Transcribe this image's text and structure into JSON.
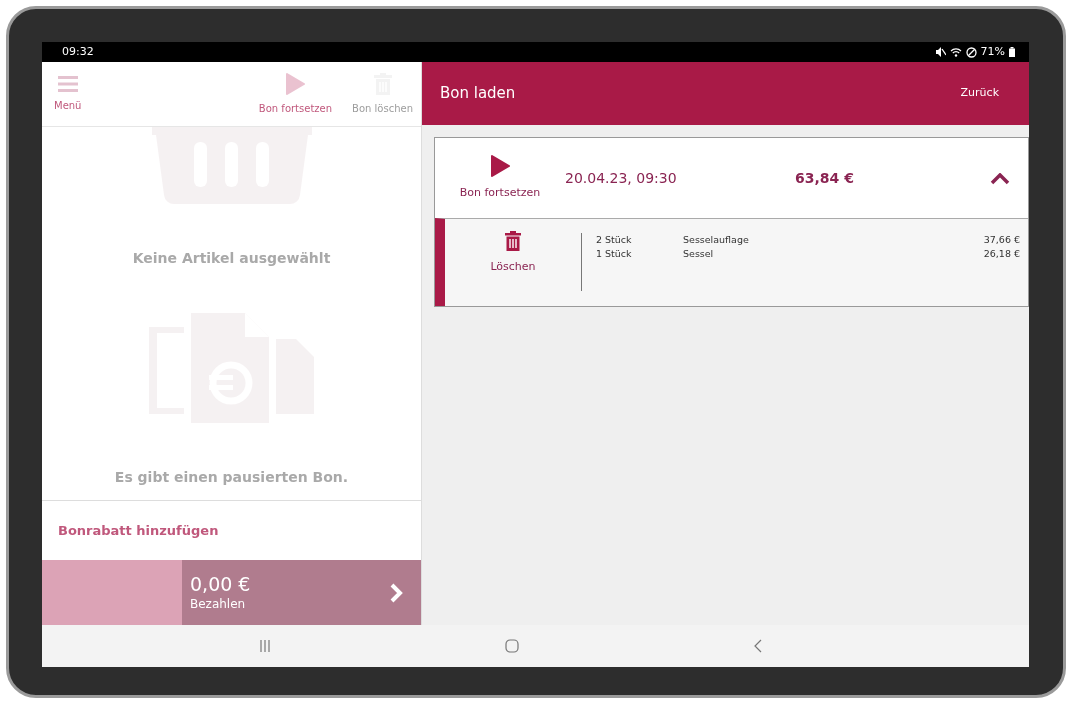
{
  "status_bar": {
    "time": "09:32",
    "battery": "71%"
  },
  "left_panel": {
    "dimmed": true,
    "toolbar": [
      {
        "kind": "menu",
        "label": "Menü",
        "disabled": false
      },
      {
        "kind": "play",
        "label": "Bon fortsetzen",
        "disabled": false
      },
      {
        "kind": "trash",
        "label": "Bon löschen",
        "disabled": true
      }
    ],
    "empty_message": "Keine Artikel ausgewählt",
    "paused_message": "Es gibt einen pausierten Bon.",
    "discount_link": "Bonrabatt hinzufügen",
    "pay": {
      "amount": "0,00 €",
      "label": "Bezahlen"
    }
  },
  "right_panel": {
    "title": "Bon laden",
    "back": "Zurück",
    "receipts": [
      {
        "resume_label": "Bon fortsetzen",
        "date": "20.04.23, 09:30",
        "total": "63,84 €",
        "expanded": true,
        "delete_label": "Löschen",
        "items": [
          {
            "qty": "2 Stück",
            "name": "Sesselauflage",
            "price": "37,66 €"
          },
          {
            "qty": "1 Stück",
            "name": "Sessel",
            "price": "26,18 €"
          }
        ]
      }
    ]
  }
}
